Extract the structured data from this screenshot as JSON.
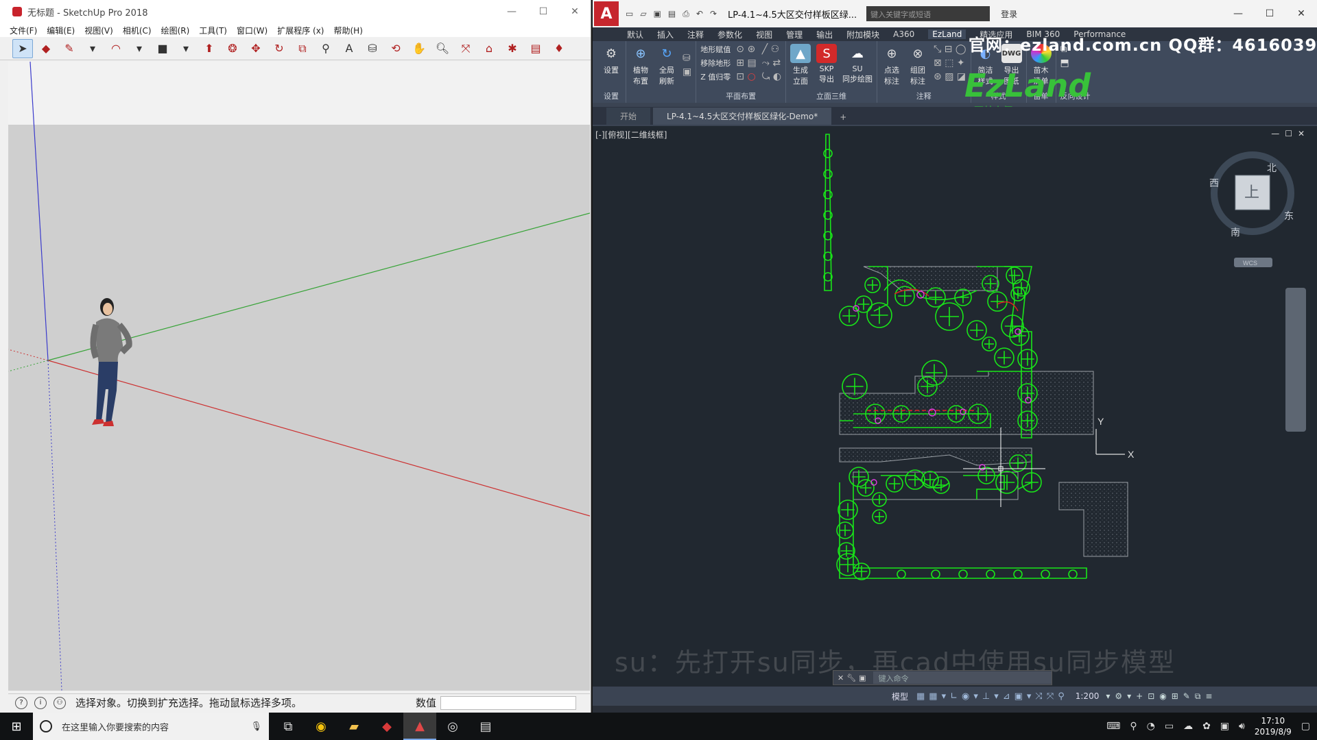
{
  "sketchup": {
    "title": "无标题 - SketchUp Pro 2018",
    "window_controls": [
      "—",
      "☐",
      "✕"
    ],
    "menu": [
      "文件(F)",
      "编辑(E)",
      "视图(V)",
      "相机(C)",
      "绘图(R)",
      "工具(T)",
      "窗口(W)",
      "扩展程序 (x)",
      "帮助(H)"
    ],
    "status_message": "选择对象。切换到扩充选择。拖动鼠标选择多项。",
    "measurements_label": "数值",
    "status_icons": [
      "?",
      "i",
      "⚇"
    ]
  },
  "autocad": {
    "logo": "A",
    "document_title": "LP-4.1~4.5大区交付样板区绿...",
    "search_placeholder": "键入关键字或短语",
    "login": "登录",
    "window_controls": [
      "—",
      "☐",
      "✕"
    ],
    "ribbon_tabs": [
      "默认",
      "插入",
      "注释",
      "参数化",
      "视图",
      "管理",
      "输出",
      "附加模块",
      "A360",
      "EzLand",
      "精选应用",
      "BIM 360",
      "Performance"
    ],
    "active_ribbon_tab": "EzLand",
    "ribbon_groups": [
      {
        "name": "设置",
        "buttons": [
          "设置"
        ]
      },
      {
        "name": "",
        "buttons": [
          "植物\n布置",
          "全局\n刷新"
        ]
      },
      {
        "name": "平面布置",
        "small": [
          "地形赋值",
          "移除地形",
          "Z 值归零"
        ]
      },
      {
        "name": "立面三维",
        "buttons": [
          "生成\n立面",
          "SKP\n导出",
          "SU\n同步绘图"
        ]
      },
      {
        "name": "注释",
        "buttons": [
          "点选\n标注",
          "组团\n标注"
        ]
      },
      {
        "name": "样式",
        "buttons": [
          "简洁\n样式",
          "导出\n图纸"
        ]
      },
      {
        "name": "苗单",
        "buttons": [
          "苗木\n清单"
        ]
      },
      {
        "name": "反向设计",
        "buttons": []
      }
    ],
    "watermark": "官网：ezland.com.cn QQ群：461603995",
    "ezland_logo": "EzLand",
    "ezland_logo_sub": "园林大师",
    "doc_tabs": [
      "开始",
      "LP-4.1~4.5大区交付样板区绿化-Demo*"
    ],
    "view_label": "[-][俯视][二维线框]",
    "viewcube": {
      "north": "北",
      "south": "南",
      "east": "东",
      "west": "西",
      "face": "上",
      "wcs": "WCS"
    },
    "ucs": {
      "x": "X",
      "y": "Y"
    },
    "subtitle": "su：先打开su同步，再cad中使用su同步模型",
    "command_placeholder": "键入命令",
    "status_model": "模型",
    "status_scale": "1:200"
  },
  "taskbar": {
    "search_placeholder": "在这里输入你要搜索的内容",
    "time": "17:10",
    "date": "2019/8/9"
  },
  "colors": {
    "plant_green": "#19e619",
    "path_grey": "#9aa0a6",
    "magenta": "#e23ce2",
    "red": "#e02020",
    "cad_bg": "#212830",
    "ribbon_bg": "#3f4a5c"
  }
}
